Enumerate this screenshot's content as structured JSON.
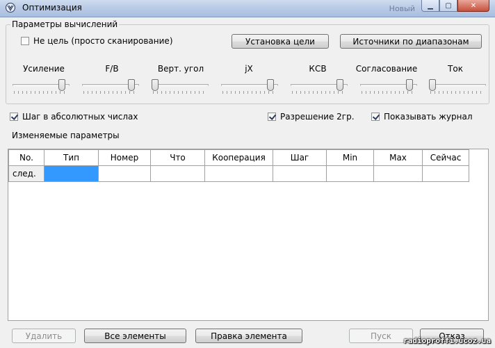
{
  "window": {
    "title": "Оптимизация",
    "background_title": "Новый",
    "min_glyph": "▁",
    "max_glyph": "▢",
    "close_glyph": "✕"
  },
  "group": {
    "legend": "Параметры вычислений",
    "not_target_label": "Не цель (просто сканирование)",
    "not_target_checked": false,
    "set_target_button": "Установка цели",
    "range_sources_button": "Источники по диапазонам"
  },
  "sliders": [
    {
      "label": "Усиление",
      "level": 0.92
    },
    {
      "label": "F/B",
      "level": 0.92
    },
    {
      "label": "Верт. угол",
      "level": 0.0
    },
    {
      "label": "jX",
      "level": 0.92
    },
    {
      "label": "КСВ",
      "level": 0.92
    },
    {
      "label": "Согласование",
      "level": 0.92
    },
    {
      "label": "Ток",
      "level": 0.0
    }
  ],
  "options": {
    "abs_step_label": "Шаг в абсолютных числах",
    "abs_step_checked": true,
    "resolution_label": "Разрешение 2гр.",
    "resolution_checked": true,
    "show_log_label": "Показывать журнал",
    "show_log_checked": true
  },
  "params_label": "Изменяемые параметры",
  "table": {
    "columns": [
      "No.",
      "Тип",
      "Номер",
      "Что",
      "Кооперация",
      "Шаг",
      "Min",
      "Max",
      "Сейчас"
    ],
    "rows": [
      [
        "след.",
        "",
        "",
        "",
        "",
        "",
        "",
        "",
        ""
      ]
    ]
  },
  "buttons": {
    "delete": "Удалить",
    "all_elements": "Все элементы",
    "edit_element": "Правка элемента",
    "start": "Пуск",
    "cancel": "Отказ"
  },
  "watermark": "radioproffi.ucoz.ua",
  "colors": {
    "selection": "#3399ff",
    "window_bg": "#f0f0f0",
    "titlebar": "#b9cbe6"
  }
}
